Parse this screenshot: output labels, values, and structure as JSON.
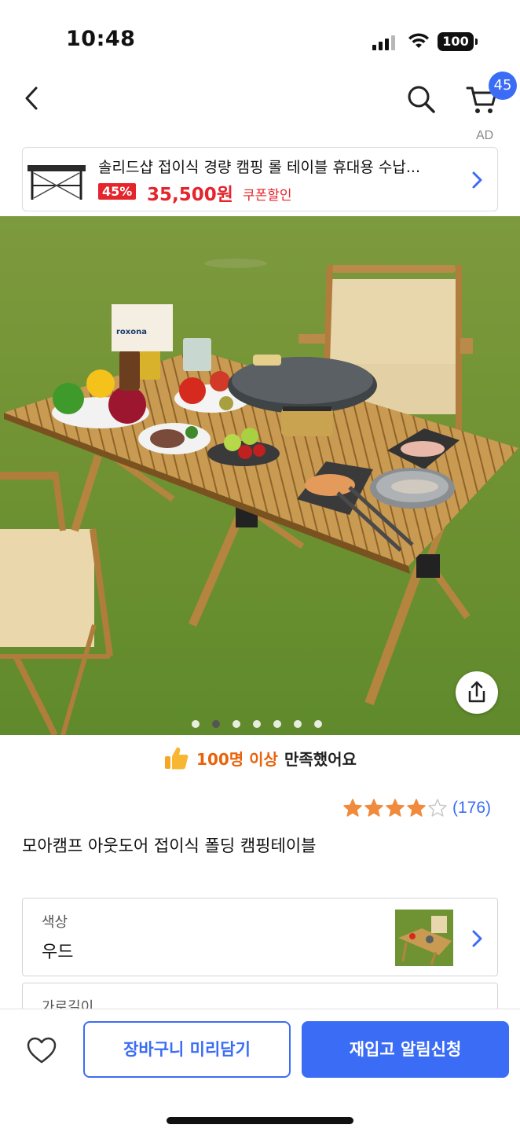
{
  "status_bar": {
    "time": "10:48",
    "battery": "100",
    "icons": [
      "signal-icon",
      "wifi-icon",
      "battery-icon"
    ]
  },
  "nav": {
    "icons": [
      "chevron-left-icon",
      "search-icon",
      "cart-icon"
    ],
    "cart_count": "45"
  },
  "ad": {
    "label": "AD",
    "title": "솔리드샵 접이식 경량 캠핑 롤 테이블 휴대용 수납...",
    "discount": "45%",
    "price": "35,500원",
    "coupon": "쿠폰할인"
  },
  "gallery": {
    "total": 7,
    "active_index": 1
  },
  "satisfaction": {
    "highlight": "100명 이상",
    "rest": "만족했어요"
  },
  "rating": {
    "stars": 4,
    "max": 5,
    "count": "(176)"
  },
  "product": {
    "name": "모아캠프 아웃도어 접이식 폴딩 캠핑테이블"
  },
  "options": [
    {
      "label": "색상",
      "value": "우드"
    },
    {
      "label": "가로길이"
    }
  ],
  "bottom": {
    "cart_button": "장바구니 미리담기",
    "restock_button": "재입고 알림신청"
  },
  "colors": {
    "accent": "#3b6cf5",
    "sale_red": "#e5242b",
    "highlight_orange": "#e8620a"
  }
}
